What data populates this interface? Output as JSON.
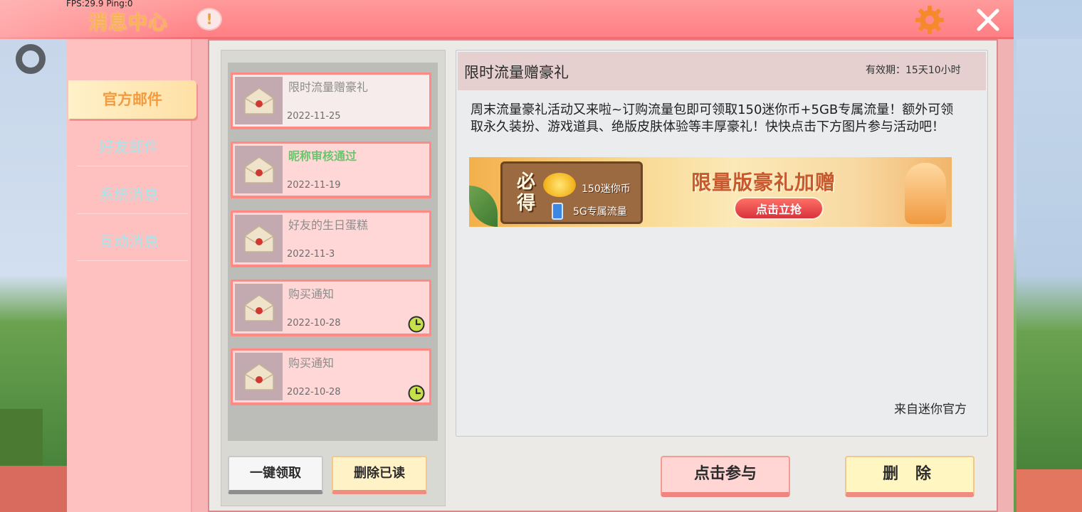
{
  "hud": {
    "fps": "FPS:29.9  Ping:0"
  },
  "header": {
    "title": "消息中心",
    "alert_symbol": "!"
  },
  "tabs": [
    {
      "label": "官方邮件",
      "active": true
    },
    {
      "label": "好友邮件",
      "active": false
    },
    {
      "label": "系统消息",
      "active": false
    },
    {
      "label": "互动消息",
      "active": false
    }
  ],
  "mails": [
    {
      "subject": "限时流量赠豪礼",
      "date": "2022-11-25",
      "selected": true,
      "has_clock": false
    },
    {
      "subject": "昵称审核通过",
      "date": "2022-11-19",
      "highlight": true,
      "has_clock": false
    },
    {
      "subject": "好友的生日蛋糕",
      "date": "2022-11-3",
      "has_clock": false
    },
    {
      "subject": "购买通知",
      "date": "2022-10-28",
      "has_clock": true
    },
    {
      "subject": "购买通知",
      "date": "2022-10-28",
      "has_clock": true
    }
  ],
  "list_buttons": {
    "collect_all": "一键领取",
    "delete_read": "删除已读"
  },
  "detail": {
    "title": "限时流量赠豪礼",
    "validity": "有效期：15天10小时",
    "body": "周末流量豪礼活动又来啦~订购流量包即可领取150迷你币+5GB专属流量！额外可领取永久装扮、游戏道具、绝版皮肤体验等丰厚豪礼！快快点击下方图片参与活动吧！",
    "banner": {
      "must_get": "必得",
      "item1": "150迷你币",
      "item2": "5G专属流量",
      "headline": "限量版豪礼加赠",
      "cta": "点击立抢"
    },
    "from": "来自迷你官方"
  },
  "detail_buttons": {
    "join": "点击参与",
    "delete": "删 除"
  },
  "colors": {
    "header": "#ff8a8e",
    "accent": "#f49a3f",
    "clock": "#c6e04a"
  }
}
